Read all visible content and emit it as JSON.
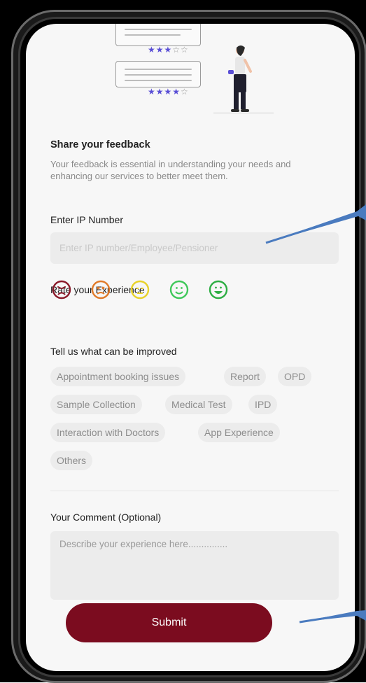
{
  "feedback": {
    "title": "Share your feedback",
    "description": "Your feedback is essential in understanding your needs and enhancing our services to better meet them."
  },
  "ip_field": {
    "label": "Enter IP Number",
    "placeholder": "Enter IP number/Employee/Pensioner"
  },
  "rating": {
    "label": "Rate your Experience",
    "options": [
      {
        "icon": "angry-face-icon",
        "color": "#8b1a2a"
      },
      {
        "icon": "tired-face-icon",
        "color": "#e07b2a"
      },
      {
        "icon": "neutral-face-icon",
        "color": "#e8d22a"
      },
      {
        "icon": "smiling-face-icon",
        "color": "#3fc85a"
      },
      {
        "icon": "happy-face-icon",
        "color": "#2eae44"
      }
    ]
  },
  "improvements": {
    "label": "Tell us what can be improved",
    "chips": [
      "Appointment booking issues",
      "Report",
      "OPD",
      "Sample Collection",
      "Medical Test",
      "IPD",
      "Interaction with Doctors",
      "App Experience",
      "Others"
    ]
  },
  "comment": {
    "label": "Your Comment (Optional)",
    "placeholder": "Describe your experience here..............."
  },
  "submit_label": "Submit",
  "colors": {
    "primary": "#7b0c1f",
    "star": "#5a4fd6",
    "annotation_arrow": "#4a7bbf"
  },
  "illustration": {
    "card_1_stars": 3,
    "card_2_stars": 4,
    "max_stars": 5
  }
}
